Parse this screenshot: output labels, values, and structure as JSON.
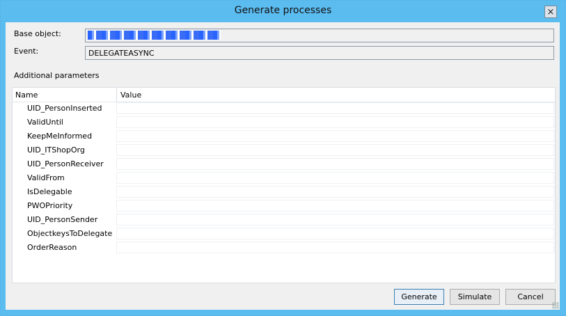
{
  "window": {
    "title": "Generate processes"
  },
  "form": {
    "base_object_label": "Base object:",
    "base_object_value": "",
    "event_label": "Event:",
    "event_value": "DELEGATEASYNC",
    "additional_params_label": "Additional parameters"
  },
  "grid": {
    "col_name": "Name",
    "col_value": "Value",
    "rows": [
      {
        "name": "UID_PersonInserted",
        "value": ""
      },
      {
        "name": "ValidUntil",
        "value": ""
      },
      {
        "name": "KeepMeInformed",
        "value": ""
      },
      {
        "name": "UID_ITShopOrg",
        "value": ""
      },
      {
        "name": "UID_PersonReceiver",
        "value": ""
      },
      {
        "name": "ValidFrom",
        "value": ""
      },
      {
        "name": "IsDelegable",
        "value": ""
      },
      {
        "name": "PWOPriority",
        "value": ""
      },
      {
        "name": "UID_PersonSender",
        "value": ""
      },
      {
        "name": "ObjectkeysToDelegate",
        "value": ""
      },
      {
        "name": "OrderReason",
        "value": ""
      }
    ]
  },
  "buttons": {
    "generate": "Generate",
    "simulate": "Simulate",
    "cancel": "Cancel",
    "close_glyph": "×"
  },
  "colors": {
    "titlebar": "#5bbcf0",
    "client_bg": "#f0f0f0"
  }
}
